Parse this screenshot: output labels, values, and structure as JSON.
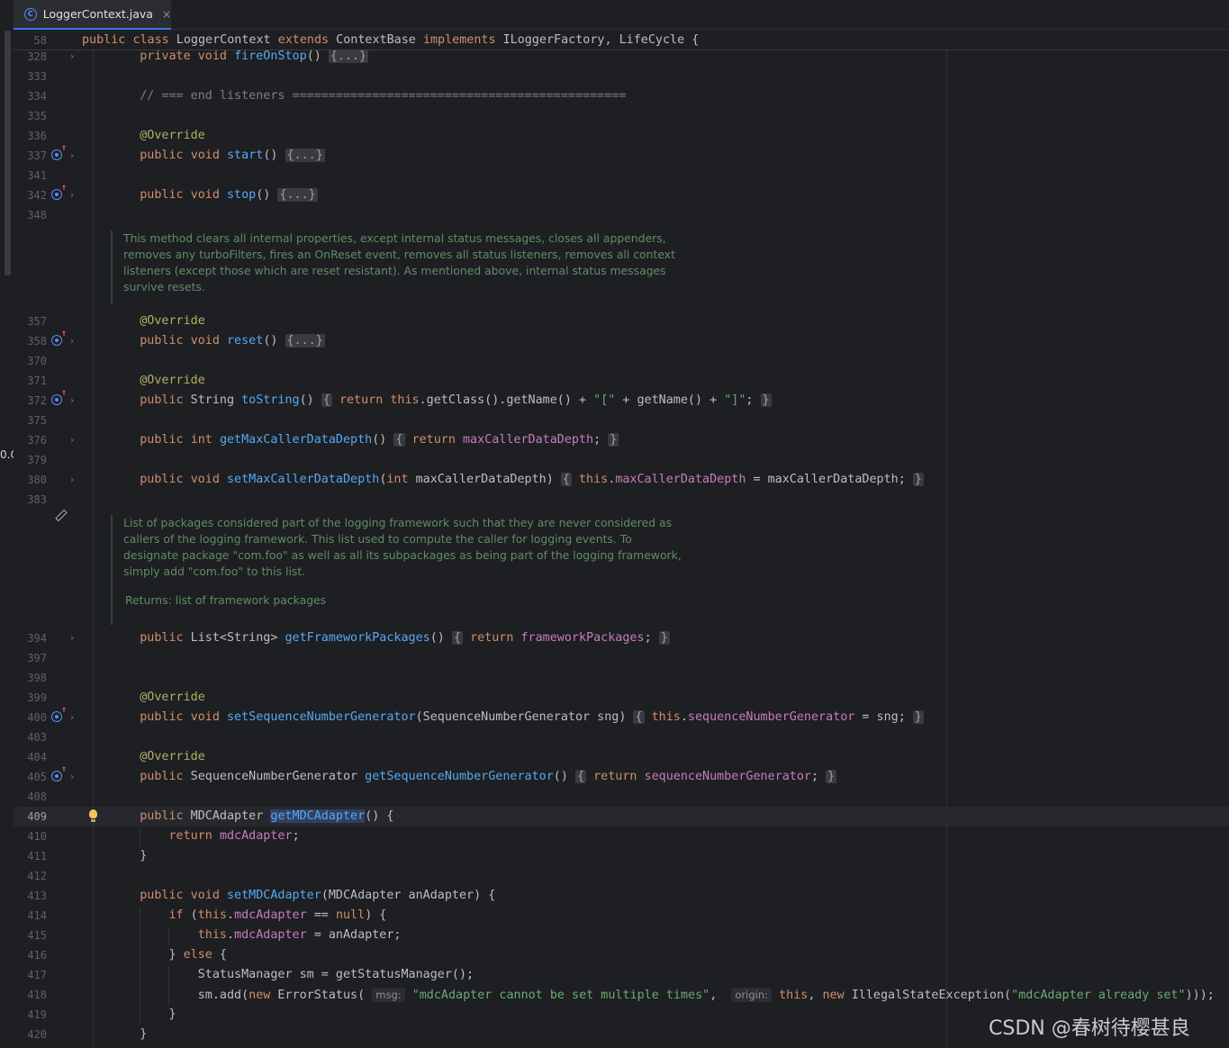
{
  "tab": {
    "file_name": "LoggerContext.java",
    "close_glyph": "×",
    "icon": "java-class-icon"
  },
  "edge_text": "0.C",
  "sticky_header": {
    "line_number": "58",
    "code": "public class LoggerContext extends ContextBase implements ILoggerFactory, LifeCycle {"
  },
  "lines": [
    {
      "n": "328",
      "code": "private void fireOnStop() {...}"
    },
    {
      "n": "333",
      "code": ""
    },
    {
      "n": "334",
      "code": "// === end listeners =============================================="
    },
    {
      "n": "335",
      "code": ""
    },
    {
      "n": "336",
      "code": "@Override"
    },
    {
      "n": "337",
      "code": "public void start() {...}"
    },
    {
      "n": "341",
      "code": ""
    },
    {
      "n": "342",
      "code": "public void stop() {...}"
    },
    {
      "n": "348",
      "code": ""
    },
    {
      "n": "357",
      "code": "@Override"
    },
    {
      "n": "358",
      "code": "public void reset() {...}"
    },
    {
      "n": "370",
      "code": ""
    },
    {
      "n": "371",
      "code": "@Override"
    },
    {
      "n": "372",
      "code": "public String toString() { return this.getClass().getName() + \"[\" + getName() + \"]\"; }"
    },
    {
      "n": "375",
      "code": ""
    },
    {
      "n": "376",
      "code": "public int getMaxCallerDataDepth() { return maxCallerDataDepth; }"
    },
    {
      "n": "379",
      "code": ""
    },
    {
      "n": "380",
      "code": "public void setMaxCallerDataDepth(int maxCallerDataDepth) { this.maxCallerDataDepth = maxCallerDataDepth; }"
    },
    {
      "n": "383",
      "code": ""
    },
    {
      "n": "394",
      "code": "public List<String> getFrameworkPackages() { return frameworkPackages; }"
    },
    {
      "n": "397",
      "code": ""
    },
    {
      "n": "398",
      "code": ""
    },
    {
      "n": "399",
      "code": "@Override"
    },
    {
      "n": "400",
      "code": "public void setSequenceNumberGenerator(SequenceNumberGenerator sng) { this.sequenceNumberGenerator = sng; }"
    },
    {
      "n": "403",
      "code": ""
    },
    {
      "n": "404",
      "code": "@Override"
    },
    {
      "n": "405",
      "code": "public SequenceNumberGenerator getSequenceNumberGenerator() { return sequenceNumberGenerator; }"
    },
    {
      "n": "408",
      "code": ""
    },
    {
      "n": "409",
      "code": "public MDCAdapter getMDCAdapter() {"
    },
    {
      "n": "410",
      "code": "return mdcAdapter;"
    },
    {
      "n": "411",
      "code": "}"
    },
    {
      "n": "412",
      "code": ""
    },
    {
      "n": "413",
      "code": "public void setMDCAdapter(MDCAdapter anAdapter) {"
    },
    {
      "n": "414",
      "code": "if (this.mdcAdapter == null) {"
    },
    {
      "n": "415",
      "code": "this.mdcAdapter = anAdapter;"
    },
    {
      "n": "416",
      "code": "} else {"
    },
    {
      "n": "417",
      "code": "StatusManager sm = getStatusManager();"
    },
    {
      "n": "418",
      "code": "sm.add(new ErrorStatus( msg: \"mdcAdapter cannot be set multiple times\",  origin: this, new IllegalStateException(\"mdcAdapter already set\")));"
    },
    {
      "n": "419",
      "code": "}"
    },
    {
      "n": "420",
      "code": "}"
    }
  ],
  "docs": {
    "reset_doc": [
      "This method clears all internal properties, except internal status messages, closes all appenders,",
      "removes any turboFilters, fires an OnReset event, removes all status listeners, removes all context",
      "listeners (except those which are reset resistant). As mentioned above, internal status messages",
      "survive resets."
    ],
    "framework_doc": [
      "List of packages considered part of the logging framework such that they are never considered as",
      "callers of the logging framework. This list used to compute the caller for logging events. To",
      "designate package \"com.foo\" as well as all its subpackages as being part of the logging framework,",
      "simply add \"com.foo\" to this list."
    ],
    "framework_returns": "Returns: list of framework packages"
  },
  "tokens": {
    "public": "public",
    "private": "private",
    "void": "void",
    "int": "int",
    "return": "return",
    "this": "this",
    "new": "new",
    "if": "if",
    "else": "else",
    "null": "null",
    "class": "class",
    "extends": "extends",
    "implements": "implements",
    "override": "@Override",
    "fold": "{...}",
    "lbrace": "{",
    "rbrace": "}",
    "s_lbr": "\"[\"",
    "s_rbr": "\"]\"",
    "msg_hint": "msg:",
    "origin_hint": "origin:",
    "s_mult": "\"mdcAdapter cannot be set multiple times\"",
    "s_already": "\"mdcAdapter already set\"",
    "comment_end_listeners": "// === end listeners ==============================================",
    "fireOnStop": "fireOnStop",
    "start": "start",
    "stop": "stop",
    "reset": "reset",
    "toString": "toString",
    "getMaxCallerDataDepth": "getMaxCallerDataDepth",
    "setMaxCallerDataDepth": "setMaxCallerDataDepth",
    "maxCallerDataDepth": "maxCallerDataDepth",
    "getFrameworkPackages": "getFrameworkPackages",
    "frameworkPackages": "frameworkPackages",
    "setSequenceNumberGenerator": "setSequenceNumberGenerator",
    "getSequenceNumberGenerator": "getSequenceNumberGenerator",
    "sequenceNumberGenerator": "sequenceNumberGenerator",
    "getMDCAdapter": "getMDCAdapter",
    "setMDCAdapter": "setMDCAdapter",
    "mdcAdapter": "mdcAdapter"
  },
  "watermark": "CSDN @春树待樱甚良"
}
